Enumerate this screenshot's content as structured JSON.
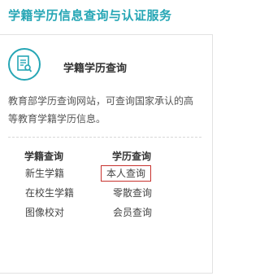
{
  "header": {
    "title": "学籍学历信息查询与认证服务"
  },
  "card": {
    "icon": "document-search-icon",
    "title": "学籍学历查询",
    "description": "教育部学历查询网站，可查询国家承认的高等教育学籍学历信息。",
    "columns": [
      {
        "heading": "学籍查询",
        "links": [
          "新生学籍",
          "在校生学籍",
          "图像校对"
        ]
      },
      {
        "heading": "学历查询",
        "links": [
          "本人查询",
          "零散查询",
          "会员查询"
        ]
      }
    ]
  },
  "colors": {
    "accent": "#26a6b5",
    "highlight_border": "#c8322e"
  }
}
